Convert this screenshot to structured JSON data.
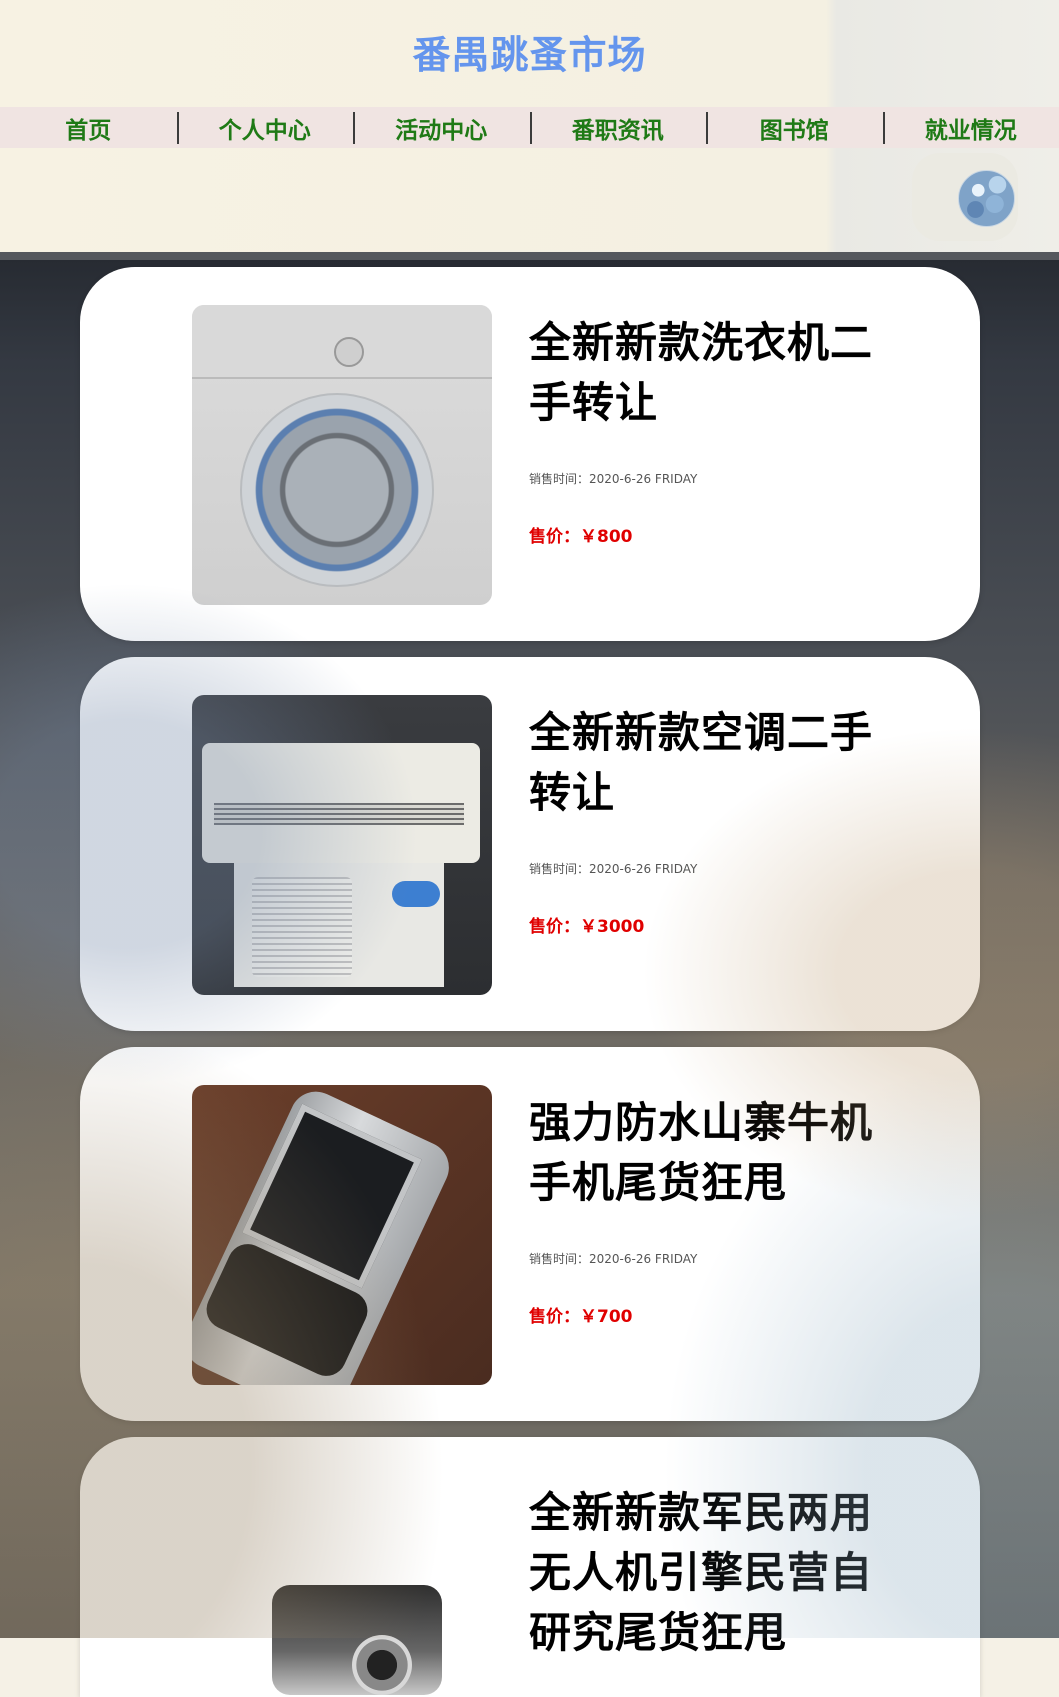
{
  "header": {
    "site_title": "番禺跳蚤市场",
    "nav": [
      "首页",
      "个人中心",
      "活动中心",
      "番职资讯",
      "图书馆",
      "就业情况"
    ]
  },
  "products": [
    {
      "title": "全新新款洗衣机二手转让",
      "date": "销售时间：2020-6-26 FRIDAY",
      "price": "售价：￥800",
      "image": "washing-machine"
    },
    {
      "title": "全新新款空调二手转让",
      "date": "销售时间：2020-6-26 FRIDAY",
      "price": "售价：￥3000",
      "image": "air-conditioner"
    },
    {
      "title": "强力防水山寨牛机手机尾货狂甩",
      "date": "销售时间：2020-6-26 FRIDAY",
      "price": "售价：￥700",
      "image": "nokia-phone"
    },
    {
      "title": "全新新款军民两用无人机引擎民营自研究尾货狂甩",
      "date": "",
      "price": "",
      "image": "drone-engine"
    }
  ]
}
